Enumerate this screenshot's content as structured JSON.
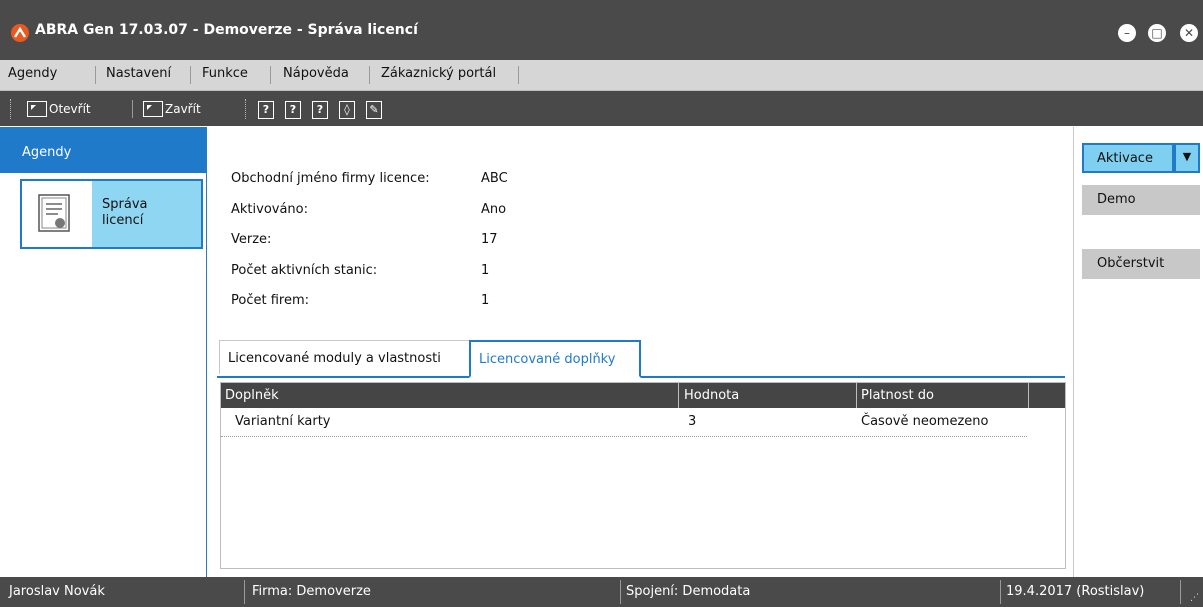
{
  "window": {
    "title": "ABRA Gen 17.03.07 - Demoverze - Správa licencí",
    "minimize_glyph": "–",
    "maximize_glyph": "□",
    "close_glyph": "✕"
  },
  "menu": {
    "items": [
      "Agendy",
      "Nastavení",
      "Funkce",
      "Nápověda",
      "Zákaznický portál"
    ]
  },
  "toolbar": {
    "open_label": "Otevřít",
    "close_label": "Zavřít",
    "help_icons": [
      "help-icon",
      "help-context-icon",
      "help-topics-icon",
      "help-index-icon",
      "help-edit-icon"
    ]
  },
  "sidebar": {
    "header": "Agendy",
    "tile_label": "Správa licencí"
  },
  "license_info": {
    "rows": [
      {
        "label": "Obchodní jméno firmy licence:",
        "value": "ABC"
      },
      {
        "label": "Aktivováno:",
        "value": "Ano"
      },
      {
        "label": "Verze:",
        "value": "17"
      },
      {
        "label": "Počet aktivních stanic:",
        "value": "1"
      },
      {
        "label": "Počet firem:",
        "value": "1"
      }
    ]
  },
  "tabs": [
    {
      "label": "Licencované moduly a vlastnosti",
      "active": false
    },
    {
      "label": "Licencované doplňky",
      "active": true
    }
  ],
  "grid": {
    "columns": [
      "Doplněk",
      "Hodnota",
      "Platnost do"
    ],
    "rows": [
      [
        "Variantní karty",
        "3",
        "Časově neomezeno"
      ]
    ]
  },
  "actions": {
    "activate_label": "Aktivace",
    "demo_label": "Demo",
    "refresh_label": "Občerstvit"
  },
  "statusbar": {
    "user": "Jaroslav Novák",
    "company": "Firma: Demoverze",
    "connection": "Spojení: Demodata",
    "date": "19.4.2017 (Rostislav)"
  },
  "colors": {
    "accent": "#1f7bc9",
    "tile_background": "#8fd6f2",
    "titlebar": "#4a4a4a",
    "logo": "#e9591f"
  }
}
